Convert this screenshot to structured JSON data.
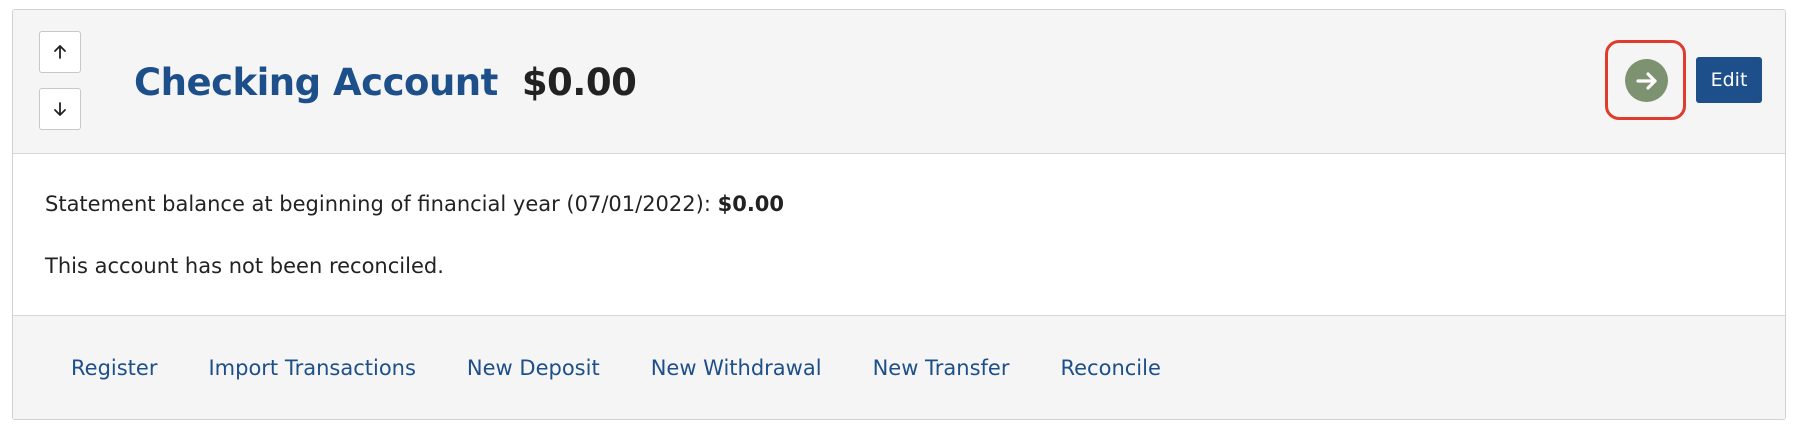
{
  "header": {
    "account_name": "Checking Account",
    "account_balance": "$0.00",
    "move_up_icon": "arrow-up-icon",
    "move_down_icon": "arrow-down-icon",
    "go_icon": "arrow-right-circle-icon",
    "edit_label": "Edit"
  },
  "body": {
    "statement_prefix": "Statement balance at beginning of financial year (07/01/2022):",
    "statement_value": "$0.00",
    "reconcile_status": "This account has not been reconciled."
  },
  "footer": {
    "links": [
      {
        "label": "Register"
      },
      {
        "label": "Import Transactions"
      },
      {
        "label": "New Deposit"
      },
      {
        "label": "New Withdrawal"
      },
      {
        "label": "New Transfer"
      },
      {
        "label": "Reconcile"
      }
    ]
  },
  "colors": {
    "brand_blue": "#1d4f8a",
    "go_button_green": "#7d9270",
    "highlight_red": "#e03b2c",
    "header_bg": "#f5f5f5"
  }
}
